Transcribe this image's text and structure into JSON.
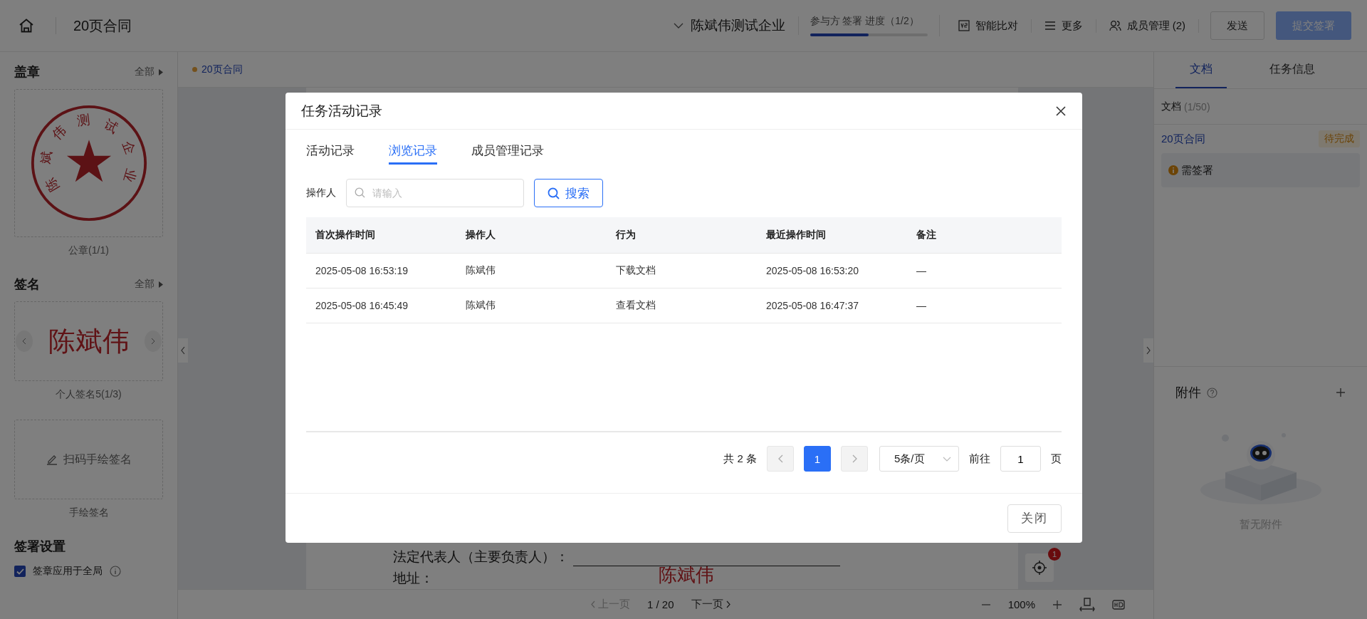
{
  "topbar": {
    "title": "20页合同",
    "company": "陈斌伟测试企业",
    "progress": {
      "label": "参与方 签署 进度（1/2）",
      "level": 0.5
    },
    "actions": [
      {
        "kind": "compare",
        "label": "智能比对"
      },
      {
        "kind": "more",
        "label": "更多"
      },
      {
        "kind": "members",
        "label": "成员管理 (2)"
      }
    ],
    "buttons": [
      {
        "kind": "send",
        "label": "发送",
        "disabled": false
      },
      {
        "kind": "submit",
        "label": "提交签署",
        "disabled": true
      }
    ]
  },
  "seals": {
    "title": "盖章",
    "more": "全部",
    "seal_text": "陈斌伟测试企业",
    "caption": "公章(1/1)"
  },
  "signatures": {
    "title": "签名",
    "more": "全部",
    "signature": "陈斌伟",
    "caption": "个人签名5(1/3)",
    "handwrite_button": "扫码手绘签名",
    "handwrite_caption": "手绘签名"
  },
  "settings": {
    "title": "签署设置",
    "options": [
      {
        "label": "签章应用于全局",
        "checked": true
      }
    ]
  },
  "document": {
    "name": "20页合同",
    "lines": [
      {
        "kind": "blank",
        "label": "法定代表人（主要负责人）："
      },
      {
        "kind": "plain",
        "label": "地址："
      }
    ],
    "signature": "陈斌伟",
    "badge": "1"
  },
  "pager": {
    "prev": "上一页",
    "page": "1 / 20",
    "next": "下一页",
    "zoom": "100%"
  },
  "right_panel": {
    "tabs": [
      {
        "label": "文档",
        "selected": true
      },
      {
        "label": "任务信息",
        "selected": false
      }
    ],
    "doc_count_label": "文档",
    "doc_count": "(1/50)",
    "documents": [
      {
        "name": "20页合同",
        "status": "待完成",
        "tasks": [
          "需签署"
        ]
      }
    ],
    "attachments": {
      "title": "附件",
      "empty": "暂无附件"
    }
  },
  "dialog": {
    "title": "任务活动记录",
    "tabs": [
      {
        "label": "活动记录",
        "selected": false
      },
      {
        "label": "浏览记录",
        "selected": true
      },
      {
        "label": "成员管理记录",
        "selected": false
      }
    ],
    "filter": {
      "label": "操作人",
      "placeholder": "请输入",
      "button": "搜索"
    },
    "table": {
      "columns": [
        "首次操作时间",
        "操作人",
        "行为",
        "最近操作时间",
        "备注"
      ],
      "rows": [
        [
          "2025-05-08 16:53:19",
          "陈斌伟",
          "下载文档",
          "2025-05-08 16:53:20",
          "—"
        ],
        [
          "2025-05-08 16:45:49",
          "陈斌伟",
          "查看文档",
          "2025-05-08 16:47:37",
          "—"
        ]
      ]
    },
    "pagination": {
      "total": "共 2 条",
      "pages": [
        {
          "label": "1",
          "selected": true
        }
      ],
      "page_size": "5条/页",
      "goto_label": "前往",
      "goto_value": "1",
      "goto_suffix": "页"
    },
    "close_button": "关闭"
  }
}
